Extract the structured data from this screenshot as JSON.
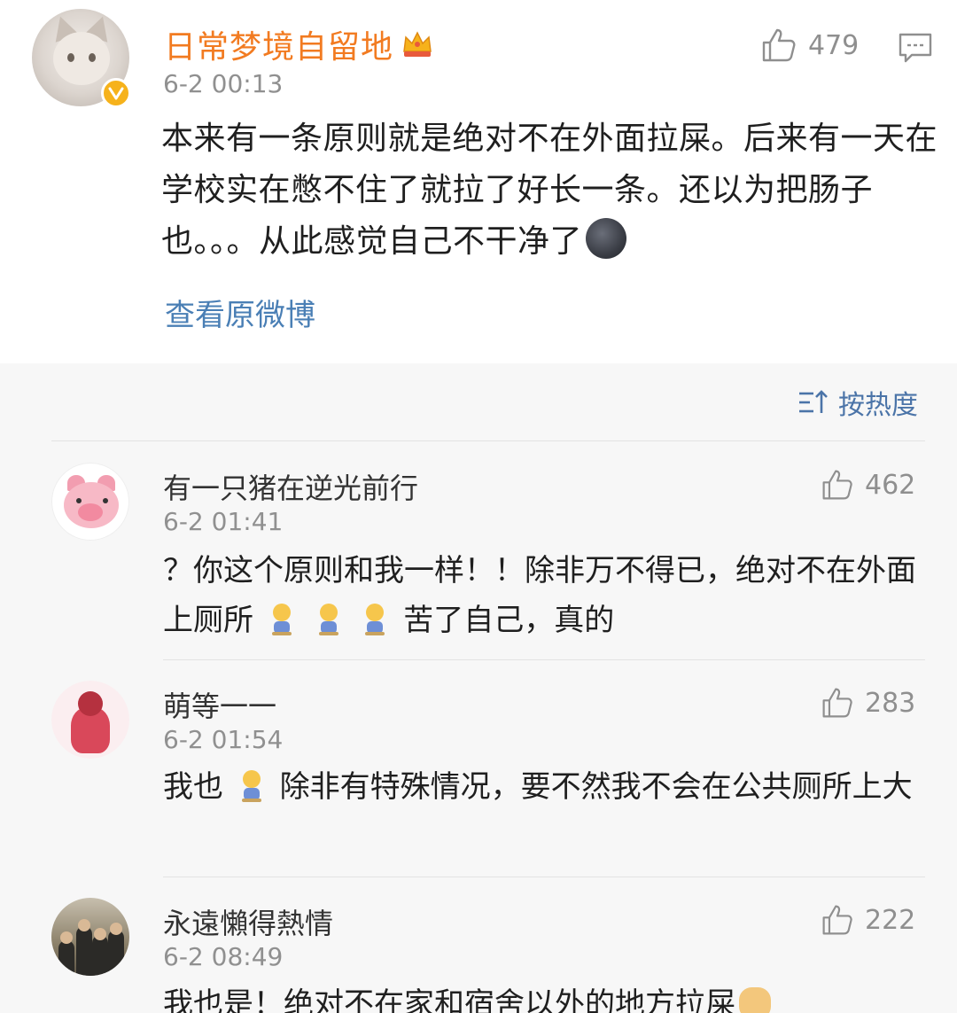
{
  "post": {
    "author": "日常梦境自留地",
    "time": "6-2 00:13",
    "likes": "479",
    "text": "本来有一条原则就是绝对不在外面拉屎。后来有一天在学校实在憋不住了就拉了好长一条。还以为把肠子也。。。从此感觉自己不干净了",
    "view_original": "查看原微博"
  },
  "sort": {
    "label": "按热度"
  },
  "comments": [
    {
      "author": "有一只猪在逆光前行",
      "time": "6-2 01:41",
      "likes": "462",
      "text_a": "？你这个原则和我一样！！除非万不得已，绝对不在外面上厕所",
      "text_b": "苦了自己，真的"
    },
    {
      "author": "萌等一一",
      "time": "6-2 01:54",
      "likes": "283",
      "text_a": "我也",
      "text_b": "除非有特殊情况，要不然我不会在公共厕所上大"
    },
    {
      "author": "永遠懶得熱情",
      "time": "6-2 08:49",
      "likes": "222",
      "text_a": "我也是！绝对不在家和宿舍以外的地方拉屎"
    }
  ],
  "colors": {
    "author_highlight": "#f27b21",
    "link": "#4a7fb5",
    "verified": "#f6b21b"
  }
}
